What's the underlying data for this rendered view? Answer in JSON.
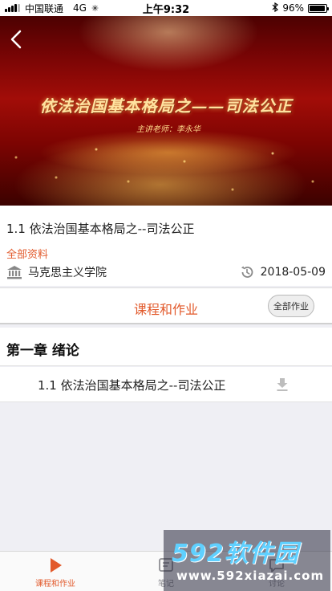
{
  "status_bar": {
    "carrier": "中国联通",
    "network": "4G",
    "time": "上午9:32",
    "battery_text": "96%",
    "battery_level": 0.96
  },
  "hero": {
    "title": "依法治国基本格局之——司法公正",
    "teacher": "主讲老师：李永华",
    "back_icon": "chevron-left-icon"
  },
  "course": {
    "title": "1.1 依法治国基本格局之--司法公正",
    "all_materials": "全部资料",
    "school": "马克思主义学院",
    "date": "2018-05-09",
    "accent_color": "#e25a2c"
  },
  "section_tab": {
    "label": "课程和作业",
    "all_homework": "全部作业"
  },
  "chapters": [
    {
      "title": "第一章 绪论",
      "lessons": [
        {
          "title": "1.1 依法治国基本格局之--司法公正"
        }
      ]
    }
  ],
  "tab_bar": {
    "items": [
      {
        "label": "课程和作业",
        "icon": "play-icon",
        "active": true
      },
      {
        "label": "笔记",
        "icon": "note-icon",
        "active": false
      },
      {
        "label": "讨论",
        "icon": "chat-icon",
        "active": false
      }
    ]
  },
  "watermark": {
    "brand": "592软件园",
    "url": "www.592xiazai.com"
  }
}
